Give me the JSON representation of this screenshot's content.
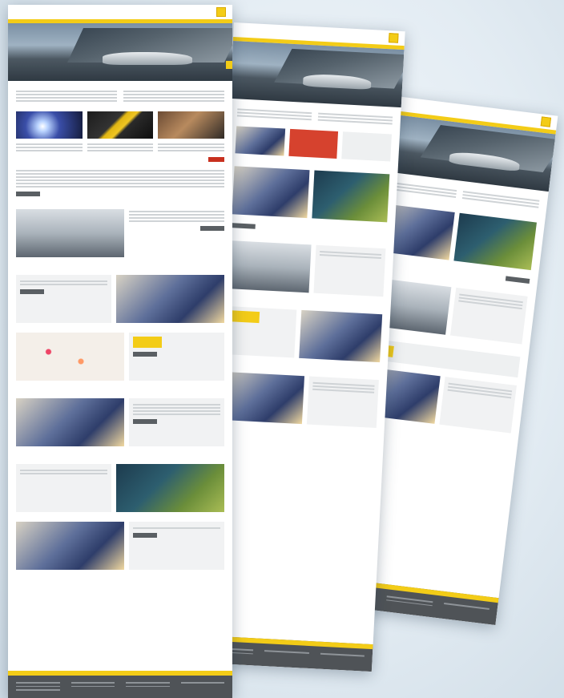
{
  "sheets": [
    {
      "id": "back"
    },
    {
      "id": "middle"
    },
    {
      "id": "front"
    }
  ],
  "colors": {
    "accent_yellow": "#f3cc17",
    "footer_grey": "#4f5357",
    "button_dark": "#5a5f63",
    "button_red": "#c8301f",
    "background": "#e3ecf3"
  },
  "icons": [
    "logo-icon"
  ]
}
